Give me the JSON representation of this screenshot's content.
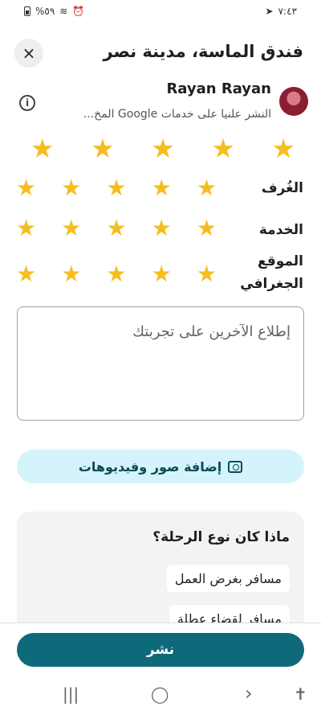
{
  "status_bar": {
    "time": "٧:٤٣",
    "battery_percent": "%٥٩"
  },
  "header": {
    "title": "فندق الماسة، مدينة نصر",
    "close_icon": "×"
  },
  "user": {
    "name": "Rayan Rayan",
    "subtitle": "النشر علنيا على خدمات Google المخ...",
    "info_icon": "i"
  },
  "overall_rating": {
    "value": 5,
    "max": 5
  },
  "category_ratings": [
    {
      "label": "الغُرف",
      "value": 5
    },
    {
      "label": "الخدمة",
      "value": 5
    },
    {
      "label": "الموقع الجغرافي",
      "value": 5
    }
  ],
  "review": {
    "placeholder": "إطلاع الآخرين على تجربتك"
  },
  "add_media": {
    "label": "إضافة صور وفيديوهات"
  },
  "trip_type": {
    "question": "ماذا كان نوع الرحلة؟",
    "options": [
      "مسافر بغرض العمل",
      "مسافر لقضاء عطلة"
    ]
  },
  "post_button": {
    "label": "نشر"
  },
  "nav": {
    "recents": "|||",
    "home": "◯",
    "back": "›",
    "accessibility": "✝"
  },
  "colors": {
    "star": "#f5bd1f",
    "primary": "#0e6a7a",
    "chip_bg": "#d5f3fb"
  }
}
